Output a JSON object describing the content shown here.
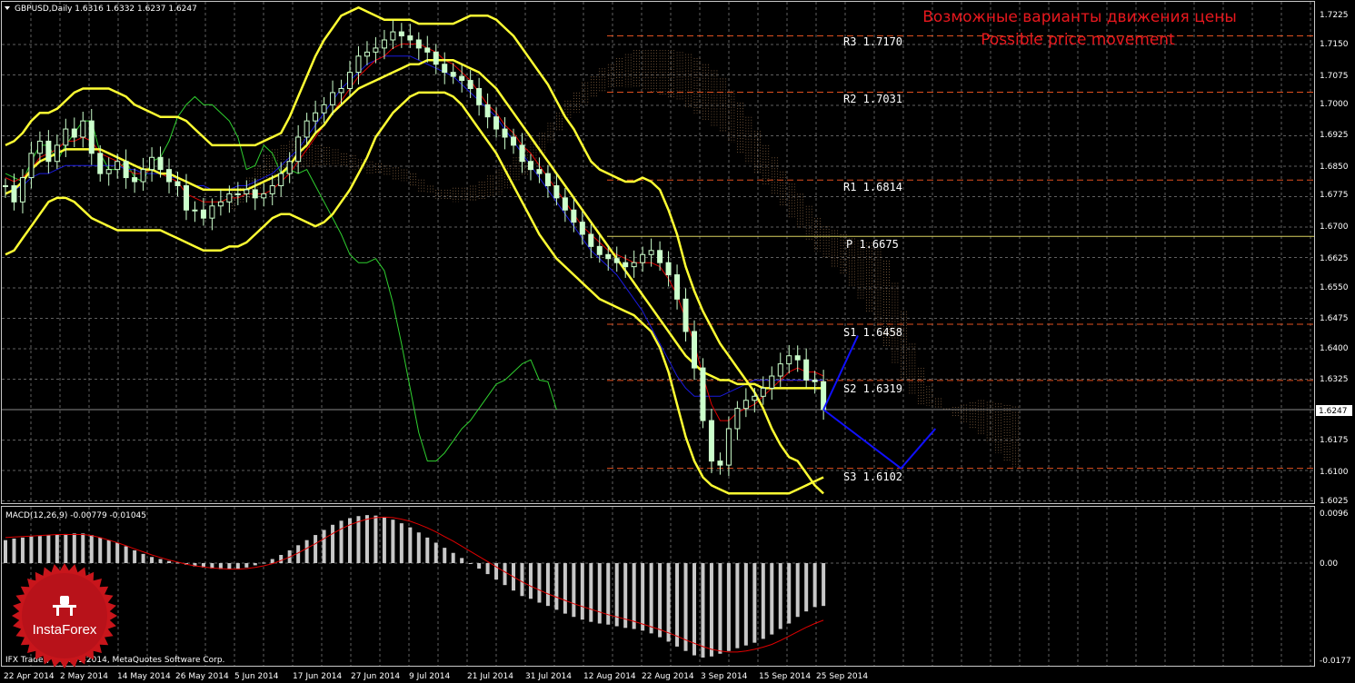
{
  "colors": {
    "background": "#000000",
    "grid": "#5f5f5f",
    "frame": "#c8c8c8",
    "candle": "#ccffcc",
    "bollinger": "#ffff33",
    "tenkan": "#e00000",
    "kijun": "#1a1adc",
    "chikou": "#2fcf2f",
    "cloud": "#d9a06a",
    "pivot_r": "#e05020",
    "pivot_p": "#d8d060",
    "forecast": "#1010ff",
    "macd_hist": "#c8c8c8",
    "macd_signal": "#e00000",
    "annotation": "#e8181e",
    "logo": "#c8151b"
  },
  "header": {
    "title": "GBPUSD,Daily  1.6316 1.6332 1.6237 1.6247"
  },
  "annotation": {
    "line1": "Возможные варианты движения цены",
    "line2": "Possible price movement"
  },
  "pivots": {
    "r3": "R3  1.7170",
    "r2": "R2  1.7031",
    "r1": "R1  1.6814",
    "p": "P  1.6675",
    "s1": "S1  1.6458",
    "s2": "S2  1.6319",
    "s3": "S3  1.6102"
  },
  "price_axis": {
    "labels": [
      "1.7225",
      "1.7150",
      "1.7075",
      "1.7000",
      "1.6925",
      "1.6850",
      "1.6775",
      "1.6700",
      "1.6625",
      "1.6550",
      "1.6475",
      "1.6400",
      "1.6325",
      "1.6175",
      "1.6100",
      "1.6025"
    ],
    "current": "1.6247"
  },
  "macd": {
    "label": "MACD(12,26,9) -0.00779 -0.01045",
    "axis": [
      "0.0096",
      "0.00",
      "-0.0177"
    ]
  },
  "date_axis": [
    "22 Apr 2014",
    "2 May 2014",
    "14 May 2014",
    "26 May 2014",
    "5 Jun 2014",
    "17 Jun 2014",
    "27 Jun 2014",
    "9 Jul 2014",
    "21 Jul 2014",
    "31 Jul 2014",
    "12 Aug 2014",
    "22 Aug 2014",
    "3 Sep 2014",
    "15 Sep 2014",
    "25 Sep 2014"
  ],
  "footer": {
    "copyright": "IFX Trader, © 2001-2014, MetaQuotes Software Corp."
  },
  "logo": {
    "text": "InstaForex"
  },
  "chart_data": {
    "type": "line",
    "symbol": "GBPUSD",
    "timeframe": "Daily",
    "ylim": [
      1.6025,
      1.7225
    ],
    "last_price": 1.6247,
    "pivot_levels": {
      "R3": 1.717,
      "R2": 1.7031,
      "R1": 1.6814,
      "P": 1.6675,
      "S1": 1.6458,
      "S2": 1.6319,
      "S3": 1.6102
    },
    "closes": [
      1.68,
      1.676,
      1.682,
      1.688,
      1.691,
      1.686,
      1.69,
      1.694,
      1.692,
      1.696,
      1.688,
      1.683,
      1.684,
      1.686,
      1.682,
      1.681,
      1.684,
      1.687,
      1.684,
      1.681,
      1.68,
      1.674,
      1.674,
      1.672,
      1.675,
      1.676,
      1.678,
      1.678,
      1.679,
      1.677,
      1.678,
      1.68,
      1.683,
      1.686,
      1.692,
      1.696,
      1.698,
      1.7,
      1.703,
      1.704,
      1.708,
      1.712,
      1.713,
      1.714,
      1.716,
      1.718,
      1.717,
      1.716,
      1.714,
      1.713,
      1.71,
      1.708,
      1.707,
      1.706,
      1.704,
      1.7,
      1.697,
      1.694,
      1.692,
      1.69,
      1.686,
      1.684,
      1.683,
      1.68,
      1.677,
      1.674,
      1.671,
      1.668,
      1.665,
      1.663,
      1.662,
      1.661,
      1.66,
      1.661,
      1.663,
      1.664,
      1.661,
      1.658,
      1.652,
      1.644,
      1.635,
      1.622,
      1.612,
      1.611,
      1.62,
      1.625,
      1.627,
      1.628,
      1.63,
      1.633,
      1.636,
      1.638,
      1.637,
      1.632,
      1.6316,
      1.6247
    ],
    "series": [
      {
        "name": "Bollinger Upper (approx.)",
        "values": [
          1.69,
          1.691,
          1.693,
          1.696,
          1.698,
          1.698,
          1.699,
          1.701,
          1.703,
          1.704,
          1.704,
          1.704,
          1.704,
          1.703,
          1.702,
          1.7,
          1.699,
          1.698,
          1.697,
          1.697,
          1.697,
          1.696,
          1.694,
          1.692,
          1.69,
          1.69,
          1.69,
          1.69,
          1.69,
          1.69,
          1.691,
          1.692,
          1.693,
          1.697,
          1.702,
          1.707,
          1.712,
          1.716,
          1.719,
          1.722,
          1.723,
          1.724,
          1.723,
          1.722,
          1.721,
          1.721,
          1.721,
          1.721,
          1.72,
          1.72,
          1.72,
          1.72,
          1.72,
          1.721,
          1.722,
          1.722,
          1.722,
          1.721,
          1.719,
          1.717,
          1.714,
          1.711,
          1.708,
          1.705,
          1.701,
          1.697,
          1.694,
          1.69,
          1.686,
          1.684,
          1.683,
          1.682,
          1.681,
          1.681,
          1.682,
          1.681,
          1.679,
          1.674,
          1.668,
          1.66,
          1.654,
          1.649,
          1.645,
          1.641,
          1.638,
          1.635,
          1.632,
          1.629,
          1.625,
          1.62,
          1.616,
          1.613,
          1.612,
          1.609,
          1.606,
          1.604
        ]
      },
      {
        "name": "Bollinger Middle (approx.)",
        "values": [
          1.678,
          1.679,
          1.681,
          1.684,
          1.686,
          1.687,
          1.688,
          1.689,
          1.689,
          1.689,
          1.689,
          1.689,
          1.688,
          1.687,
          1.686,
          1.685,
          1.684,
          1.684,
          1.683,
          1.683,
          1.682,
          1.681,
          1.68,
          1.679,
          1.679,
          1.679,
          1.679,
          1.679,
          1.679,
          1.68,
          1.681,
          1.682,
          1.683,
          1.685,
          1.688,
          1.69,
          1.693,
          1.695,
          1.698,
          1.7,
          1.702,
          1.704,
          1.705,
          1.706,
          1.707,
          1.708,
          1.709,
          1.71,
          1.71,
          1.711,
          1.711,
          1.711,
          1.711,
          1.71,
          1.709,
          1.708,
          1.706,
          1.704,
          1.701,
          1.698,
          1.695,
          1.692,
          1.689,
          1.686,
          1.683,
          1.68,
          1.677,
          1.674,
          1.671,
          1.668,
          1.665,
          1.662,
          1.659,
          1.656,
          1.653,
          1.65,
          1.647,
          1.644,
          1.641,
          1.638,
          1.636,
          1.634,
          1.633,
          1.632,
          1.632,
          1.631,
          1.631,
          1.631,
          1.63,
          1.63,
          1.63,
          1.63,
          1.63,
          1.63,
          1.63,
          1.63
        ]
      },
      {
        "name": "Bollinger Lower (approx.)",
        "values": [
          1.663,
          1.664,
          1.667,
          1.67,
          1.673,
          1.676,
          1.677,
          1.677,
          1.676,
          1.674,
          1.672,
          1.671,
          1.67,
          1.669,
          1.669,
          1.669,
          1.669,
          1.669,
          1.669,
          1.668,
          1.667,
          1.666,
          1.665,
          1.664,
          1.664,
          1.664,
          1.665,
          1.665,
          1.666,
          1.668,
          1.67,
          1.672,
          1.673,
          1.673,
          1.672,
          1.671,
          1.67,
          1.671,
          1.673,
          1.676,
          1.679,
          1.683,
          1.687,
          1.692,
          1.695,
          1.698,
          1.7,
          1.702,
          1.703,
          1.703,
          1.703,
          1.703,
          1.702,
          1.7,
          1.697,
          1.694,
          1.691,
          1.688,
          1.684,
          1.68,
          1.676,
          1.672,
          1.668,
          1.665,
          1.662,
          1.66,
          1.658,
          1.656,
          1.654,
          1.652,
          1.651,
          1.65,
          1.649,
          1.648,
          1.646,
          1.644,
          1.64,
          1.634,
          1.626,
          1.618,
          1.612,
          1.608,
          1.606,
          1.605,
          1.604,
          1.604,
          1.604,
          1.604,
          1.604,
          1.604,
          1.604,
          1.604,
          1.605,
          1.606,
          1.607,
          1.608
        ]
      },
      {
        "name": "Tenkan-sen (approx.)",
        "values": [
          1.682,
          1.681,
          1.682,
          1.684,
          1.687,
          1.688,
          1.689,
          1.691,
          1.691,
          1.692,
          1.691,
          1.688,
          1.687,
          1.686,
          1.684,
          1.683,
          1.683,
          1.684,
          1.683,
          1.682,
          1.681,
          1.678,
          1.677,
          1.676,
          1.676,
          1.676,
          1.677,
          1.677,
          1.678,
          1.678,
          1.678,
          1.679,
          1.681,
          1.683,
          1.686,
          1.689,
          1.692,
          1.695,
          1.698,
          1.701,
          1.704,
          1.707,
          1.709,
          1.711,
          1.712,
          1.714,
          1.715,
          1.715,
          1.715,
          1.714,
          1.713,
          1.711,
          1.71,
          1.708,
          1.706,
          1.703,
          1.7,
          1.698,
          1.695,
          1.693,
          1.69,
          1.688,
          1.685,
          1.682,
          1.679,
          1.676,
          1.673,
          1.67,
          1.668,
          1.666,
          1.664,
          1.663,
          1.662,
          1.661,
          1.661,
          1.661,
          1.66,
          1.657,
          1.653,
          1.647,
          1.641,
          1.633,
          1.626,
          1.622,
          1.622,
          1.624,
          1.625,
          1.626,
          1.628,
          1.63,
          1.632,
          1.634,
          1.635,
          1.634,
          1.634,
          1.633
        ]
      },
      {
        "name": "Kijun-sen (approx.)",
        "values": [
          1.678,
          1.679,
          1.68,
          1.682,
          1.683,
          1.683,
          1.684,
          1.685,
          1.685,
          1.685,
          1.685,
          1.685,
          1.685,
          1.685,
          1.684,
          1.684,
          1.683,
          1.683,
          1.683,
          1.682,
          1.682,
          1.681,
          1.68,
          1.68,
          1.679,
          1.679,
          1.679,
          1.68,
          1.68,
          1.681,
          1.682,
          1.683,
          1.685,
          1.687,
          1.689,
          1.692,
          1.695,
          1.698,
          1.701,
          1.704,
          1.706,
          1.708,
          1.71,
          1.711,
          1.712,
          1.712,
          1.712,
          1.712,
          1.711,
          1.71,
          1.709,
          1.708,
          1.707,
          1.705,
          1.703,
          1.701,
          1.699,
          1.697,
          1.694,
          1.691,
          1.688,
          1.685,
          1.682,
          1.679,
          1.676,
          1.673,
          1.67,
          1.667,
          1.664,
          1.662,
          1.66,
          1.658,
          1.655,
          1.652,
          1.649,
          1.645,
          1.641,
          1.637,
          1.633,
          1.63,
          1.628,
          1.628,
          1.628,
          1.628,
          1.629,
          1.63,
          1.631,
          1.632,
          1.632,
          1.632,
          1.632,
          1.632,
          1.632,
          1.632,
          1.632,
          1.632
        ]
      },
      {
        "name": "Chikou Span (approx.)",
        "values": [
          1.683,
          1.682,
          1.681,
          1.686,
          1.69,
          1.69,
          1.686,
          1.69,
          1.693,
          1.696,
          1.696,
          1.688,
          1.684,
          1.684,
          1.686,
          1.682,
          1.681,
          1.686,
          1.687,
          1.691,
          1.697,
          1.7,
          1.702,
          1.7,
          1.7,
          1.698,
          1.696,
          1.692,
          1.684,
          1.685,
          1.69,
          1.688,
          1.683,
          1.684,
          1.683,
          1.684,
          1.68,
          1.676,
          1.672,
          1.668,
          1.663,
          1.661,
          1.661,
          1.662,
          1.659,
          1.651,
          1.641,
          1.63,
          1.619,
          1.612,
          1.612,
          1.614,
          1.617,
          1.62,
          1.622,
          1.625,
          1.628,
          1.631,
          1.632,
          1.634,
          1.636,
          1.637,
          1.632,
          1.6316,
          1.6247
        ]
      },
      {
        "name": "MACD histogram (approx.)",
        "values": [
          0.0045,
          0.0048,
          0.005,
          0.0052,
          0.0053,
          0.0055,
          0.0056,
          0.0057,
          0.0058,
          0.0058,
          0.0055,
          0.005,
          0.0045,
          0.004,
          0.0033,
          0.0025,
          0.0018,
          0.0012,
          0.0008,
          0.0004,
          0.0001,
          -0.0003,
          -0.0006,
          -0.0008,
          -0.001,
          -0.0011,
          -0.0011,
          -0.001,
          -0.0008,
          -0.0004,
          0.0001,
          0.0008,
          0.0016,
          0.0025,
          0.0035,
          0.0045,
          0.0055,
          0.0065,
          0.0075,
          0.0083,
          0.0088,
          0.0092,
          0.0094,
          0.0093,
          0.009,
          0.0085,
          0.0078,
          0.007,
          0.006,
          0.005,
          0.004,
          0.003,
          0.002,
          0.001,
          0.0,
          -0.001,
          -0.002,
          -0.003,
          -0.004,
          -0.005,
          -0.006,
          -0.0065,
          -0.0072,
          -0.0078,
          -0.0085,
          -0.0092,
          -0.0098,
          -0.0103,
          -0.0107,
          -0.011,
          -0.0112,
          -0.0115,
          -0.0118,
          -0.012,
          -0.0123,
          -0.0128,
          -0.0135,
          -0.0143,
          -0.0152,
          -0.016,
          -0.0168,
          -0.0172,
          -0.017,
          -0.0165,
          -0.016,
          -0.0155,
          -0.015,
          -0.0145,
          -0.0138,
          -0.013,
          -0.012,
          -0.011,
          -0.0098,
          -0.0088,
          -0.008,
          -0.0078
        ]
      },
      {
        "name": "MACD signal (approx.)",
        "values": [
          0.005,
          0.0051,
          0.0052,
          0.0053,
          0.0054,
          0.0055,
          0.0056,
          0.0056,
          0.0056,
          0.0056,
          0.0054,
          0.005,
          0.0045,
          0.004,
          0.0034,
          0.0028,
          0.0022,
          0.0016,
          0.0011,
          0.0006,
          0.0002,
          -0.0002,
          -0.0005,
          -0.0007,
          -0.0009,
          -0.001,
          -0.0011,
          -0.0011,
          -0.001,
          -0.0008,
          -0.0005,
          -0.0001,
          0.0005,
          0.0012,
          0.002,
          0.0029,
          0.0038,
          0.0048,
          0.0058,
          0.0067,
          0.0075,
          0.0081,
          0.0086,
          0.0089,
          0.009,
          0.0089,
          0.0086,
          0.0082,
          0.0076,
          0.0069,
          0.0061,
          0.0052,
          0.0043,
          0.0033,
          0.0023,
          0.0013,
          0.0003,
          -0.0007,
          -0.0016,
          -0.0025,
          -0.0034,
          -0.0042,
          -0.0049,
          -0.0056,
          -0.0062,
          -0.0068,
          -0.0074,
          -0.0079,
          -0.0084,
          -0.0089,
          -0.0094,
          -0.0098,
          -0.0102,
          -0.0106,
          -0.0111,
          -0.0116,
          -0.0121,
          -0.0127,
          -0.0133,
          -0.014,
          -0.0146,
          -0.0152,
          -0.0157,
          -0.016,
          -0.0162,
          -0.0162,
          -0.016,
          -0.0157,
          -0.0153,
          -0.0148,
          -0.0141,
          -0.0133,
          -0.0125,
          -0.0117,
          -0.011,
          -0.0104
        ]
      }
    ],
    "forecast": [
      {
        "name": "up",
        "points": [
          [
            95,
            1.6247
          ],
          [
            99,
            1.643
          ]
        ]
      },
      {
        "name": "down-then-up",
        "points": [
          [
            95,
            1.6247
          ],
          [
            104,
            1.6102
          ],
          [
            108,
            1.62
          ]
        ]
      }
    ]
  }
}
